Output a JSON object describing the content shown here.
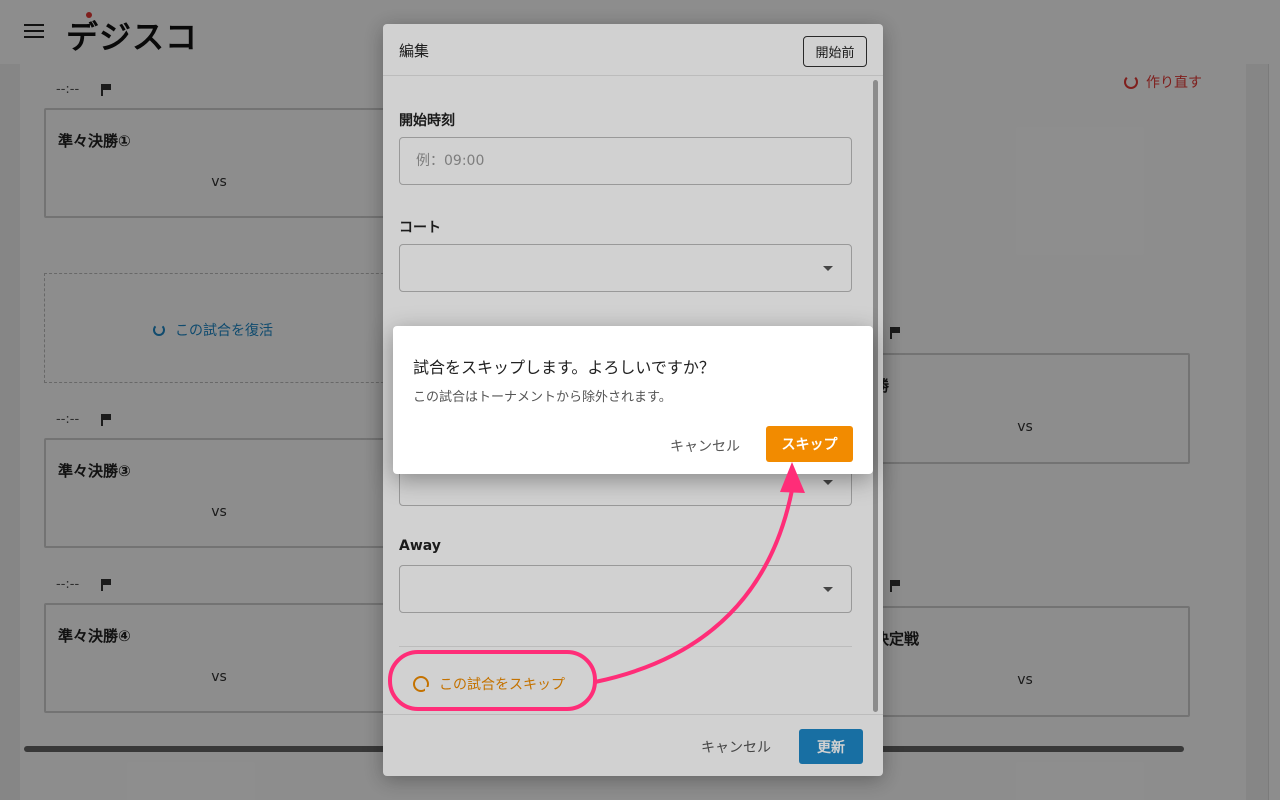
{
  "app": {
    "logo": "デジスコ"
  },
  "toolbar": {
    "redo_label": "作り直す"
  },
  "bracket": {
    "time_placeholder": "--:--",
    "matches": [
      {
        "name": "準々決勝①",
        "vs": "vs"
      },
      {
        "name": "準々決勝③",
        "vs": "vs"
      },
      {
        "name": "準々決勝④",
        "vs": "vs"
      },
      {
        "name": "勝",
        "vs": "vs"
      },
      {
        "name": "決定戦",
        "vs": "vs"
      }
    ],
    "restore_label": "この試合を復活"
  },
  "edit_modal": {
    "title": "編集",
    "status": "開始前",
    "start_time_label": "開始時刻",
    "start_time_placeholder": "例：09:00",
    "court_label": "コート",
    "away_label": "Away",
    "skip_link": "この試合をスキップ",
    "cancel": "キャンセル",
    "update": "更新"
  },
  "confirm_dialog": {
    "title": "試合をスキップします。よろしいですか？",
    "message": "この試合はトーナメントから除外されます。",
    "cancel": "キャンセル",
    "confirm": "スキップ"
  },
  "colors": {
    "accent_orange": "#f28b00",
    "primary_blue": "#1e88c7",
    "danger_red": "#e53935",
    "annotation_pink": "#ff2d78"
  }
}
